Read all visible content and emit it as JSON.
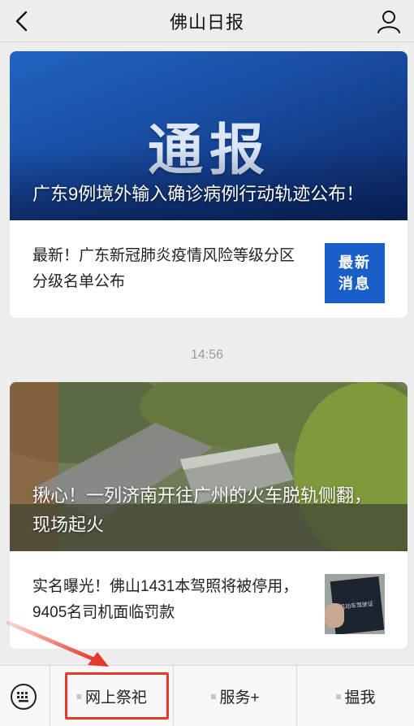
{
  "nav": {
    "title": "佛山日报",
    "back_icon": "chevron-left-icon",
    "profile_icon": "user-icon"
  },
  "articles": [
    {
      "hero_stamp": "通报",
      "hero_title": "广东9例境外输入确诊病例行动轨迹公布！",
      "sub_title": "最新！广东新冠肺炎疫情风险等级分区分级名单公布",
      "thumb_label": "最新\n消息"
    },
    {
      "hero_title": "揪心！一列济南开往广州的火车脱轨侧翻，现场起火",
      "sub_title": "实名曝光！佛山1431本驾照将被停用，9405名司机面临罚款",
      "thumb_label": "机动车驾驶证"
    }
  ],
  "timestamp": "14:56",
  "menu": {
    "keyboard_icon": "keyboard-icon",
    "items": [
      {
        "label": "网上祭祀"
      },
      {
        "label": "服务+"
      },
      {
        "label": "揾我"
      }
    ]
  },
  "colors": {
    "highlight": "#e53a2a",
    "news_blue": "#1a5fc7"
  }
}
